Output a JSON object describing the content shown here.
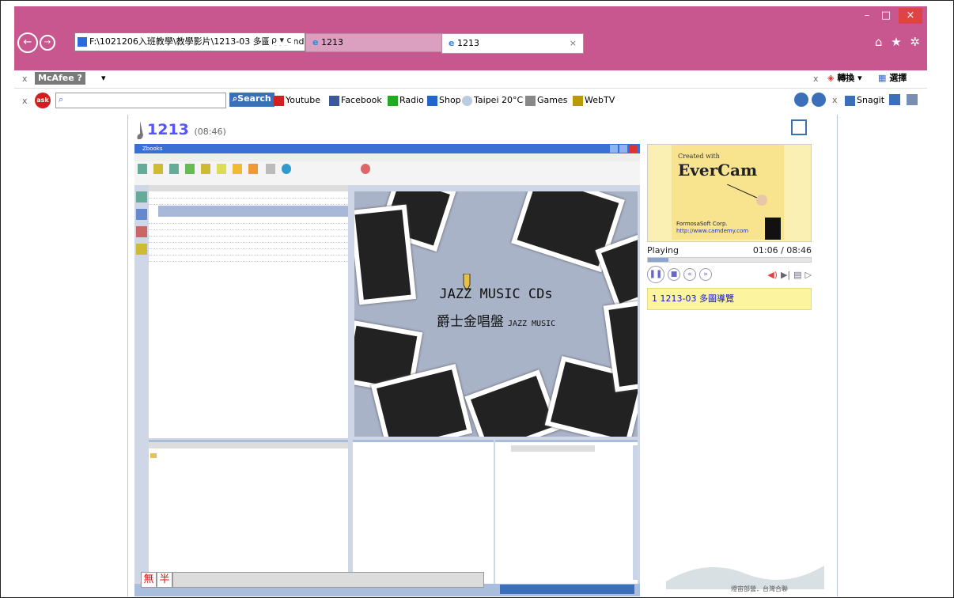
{
  "browser": {
    "address": "F:\\1021206入班教學\\教學影片\\1213-03 多圖導覽\\ind",
    "addr_icons": "ρ ▾ c",
    "tabs": [
      "1213",
      "1213"
    ],
    "tab_close": "×",
    "window_controls": {
      "min": "–",
      "max": "□",
      "close": "×"
    },
    "right_icons": "⌂ ★ ✲"
  },
  "toolbar1": {
    "close_x": "x",
    "mcafee": "McAfee",
    "mcafee_menu": "▾",
    "right_close_x": "x",
    "translate": "轉換",
    "translate_menu": "▾",
    "select": "選擇"
  },
  "toolbar2": {
    "close_x": "x",
    "ask_logo": "ask",
    "search_button": "Search",
    "links": [
      "Youtube",
      "Facebook",
      "Radio",
      "Shop",
      "Taipei 20°C",
      "Games",
      "WebTV"
    ],
    "right_close_x": "x",
    "snagit": "Snagit"
  },
  "evercam": {
    "title": "1213",
    "duration": "(08:46)",
    "logo_created": "Created with",
    "logo_name": "EverCam",
    "logo_company": "FormosaSoft Corp.",
    "logo_url": "http://www.camdemy.com",
    "status": "Playing",
    "time": "01:06 / 08:46",
    "progress_fraction": 0.125,
    "chapter": "1  1213-03 多圖導覽"
  },
  "video": {
    "app_title": "Zbooks",
    "jazz_title": "JAZZ MUSIC CDs",
    "jazz_subtitle": "爵士金唱盤",
    "jazz_subtitle2": "JAZZ MUSIC",
    "bottom_button1": "無",
    "bottom_button2": "半"
  },
  "footer": {
    "caption": "燈宙部營．台灣合聯"
  },
  "colors": {
    "titlebar": "#c9578f",
    "evercam_title": "#5555ff",
    "chapter_bg": "#fdf4a0"
  }
}
